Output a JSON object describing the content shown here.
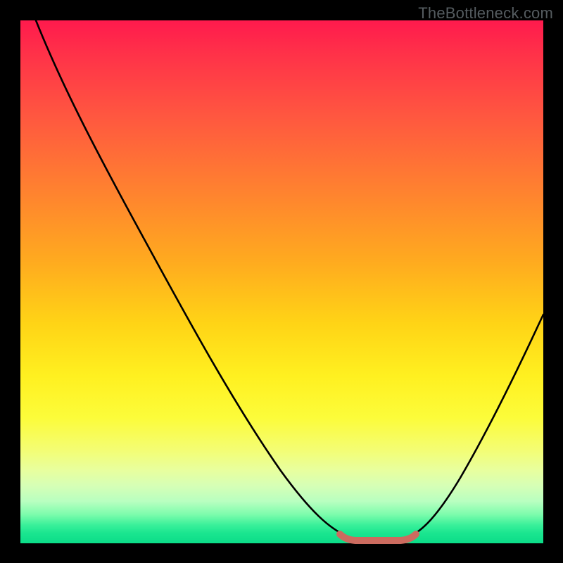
{
  "watermark": "TheBottleneck.com",
  "colors": {
    "frame": "#000000",
    "curve": "#000000",
    "marker": "#cc6b5f",
    "gradient_top": "#ff1a4d",
    "gradient_bottom": "#0bdc88"
  },
  "chart_data": {
    "type": "line",
    "title": "",
    "xlabel": "",
    "ylabel": "",
    "xlim": [
      0,
      100
    ],
    "ylim": [
      0,
      100
    ],
    "x": [
      3,
      10,
      20,
      30,
      40,
      50,
      56,
      60,
      63,
      66,
      70,
      74,
      80,
      86,
      92,
      100
    ],
    "values": [
      100,
      86,
      71,
      56,
      41,
      26,
      15,
      7,
      3,
      1,
      0,
      1,
      6,
      16,
      29,
      50
    ],
    "highlight_segment": {
      "x_start": 61,
      "x_end": 75,
      "y": 0.5
    },
    "series": [
      {
        "name": "bottleneck-curve",
        "x": [
          3,
          10,
          20,
          30,
          40,
          50,
          56,
          60,
          63,
          66,
          70,
          74,
          80,
          86,
          92,
          100
        ],
        "values": [
          100,
          86,
          71,
          56,
          41,
          26,
          15,
          7,
          3,
          1,
          0,
          1,
          6,
          16,
          29,
          50
        ]
      }
    ]
  }
}
